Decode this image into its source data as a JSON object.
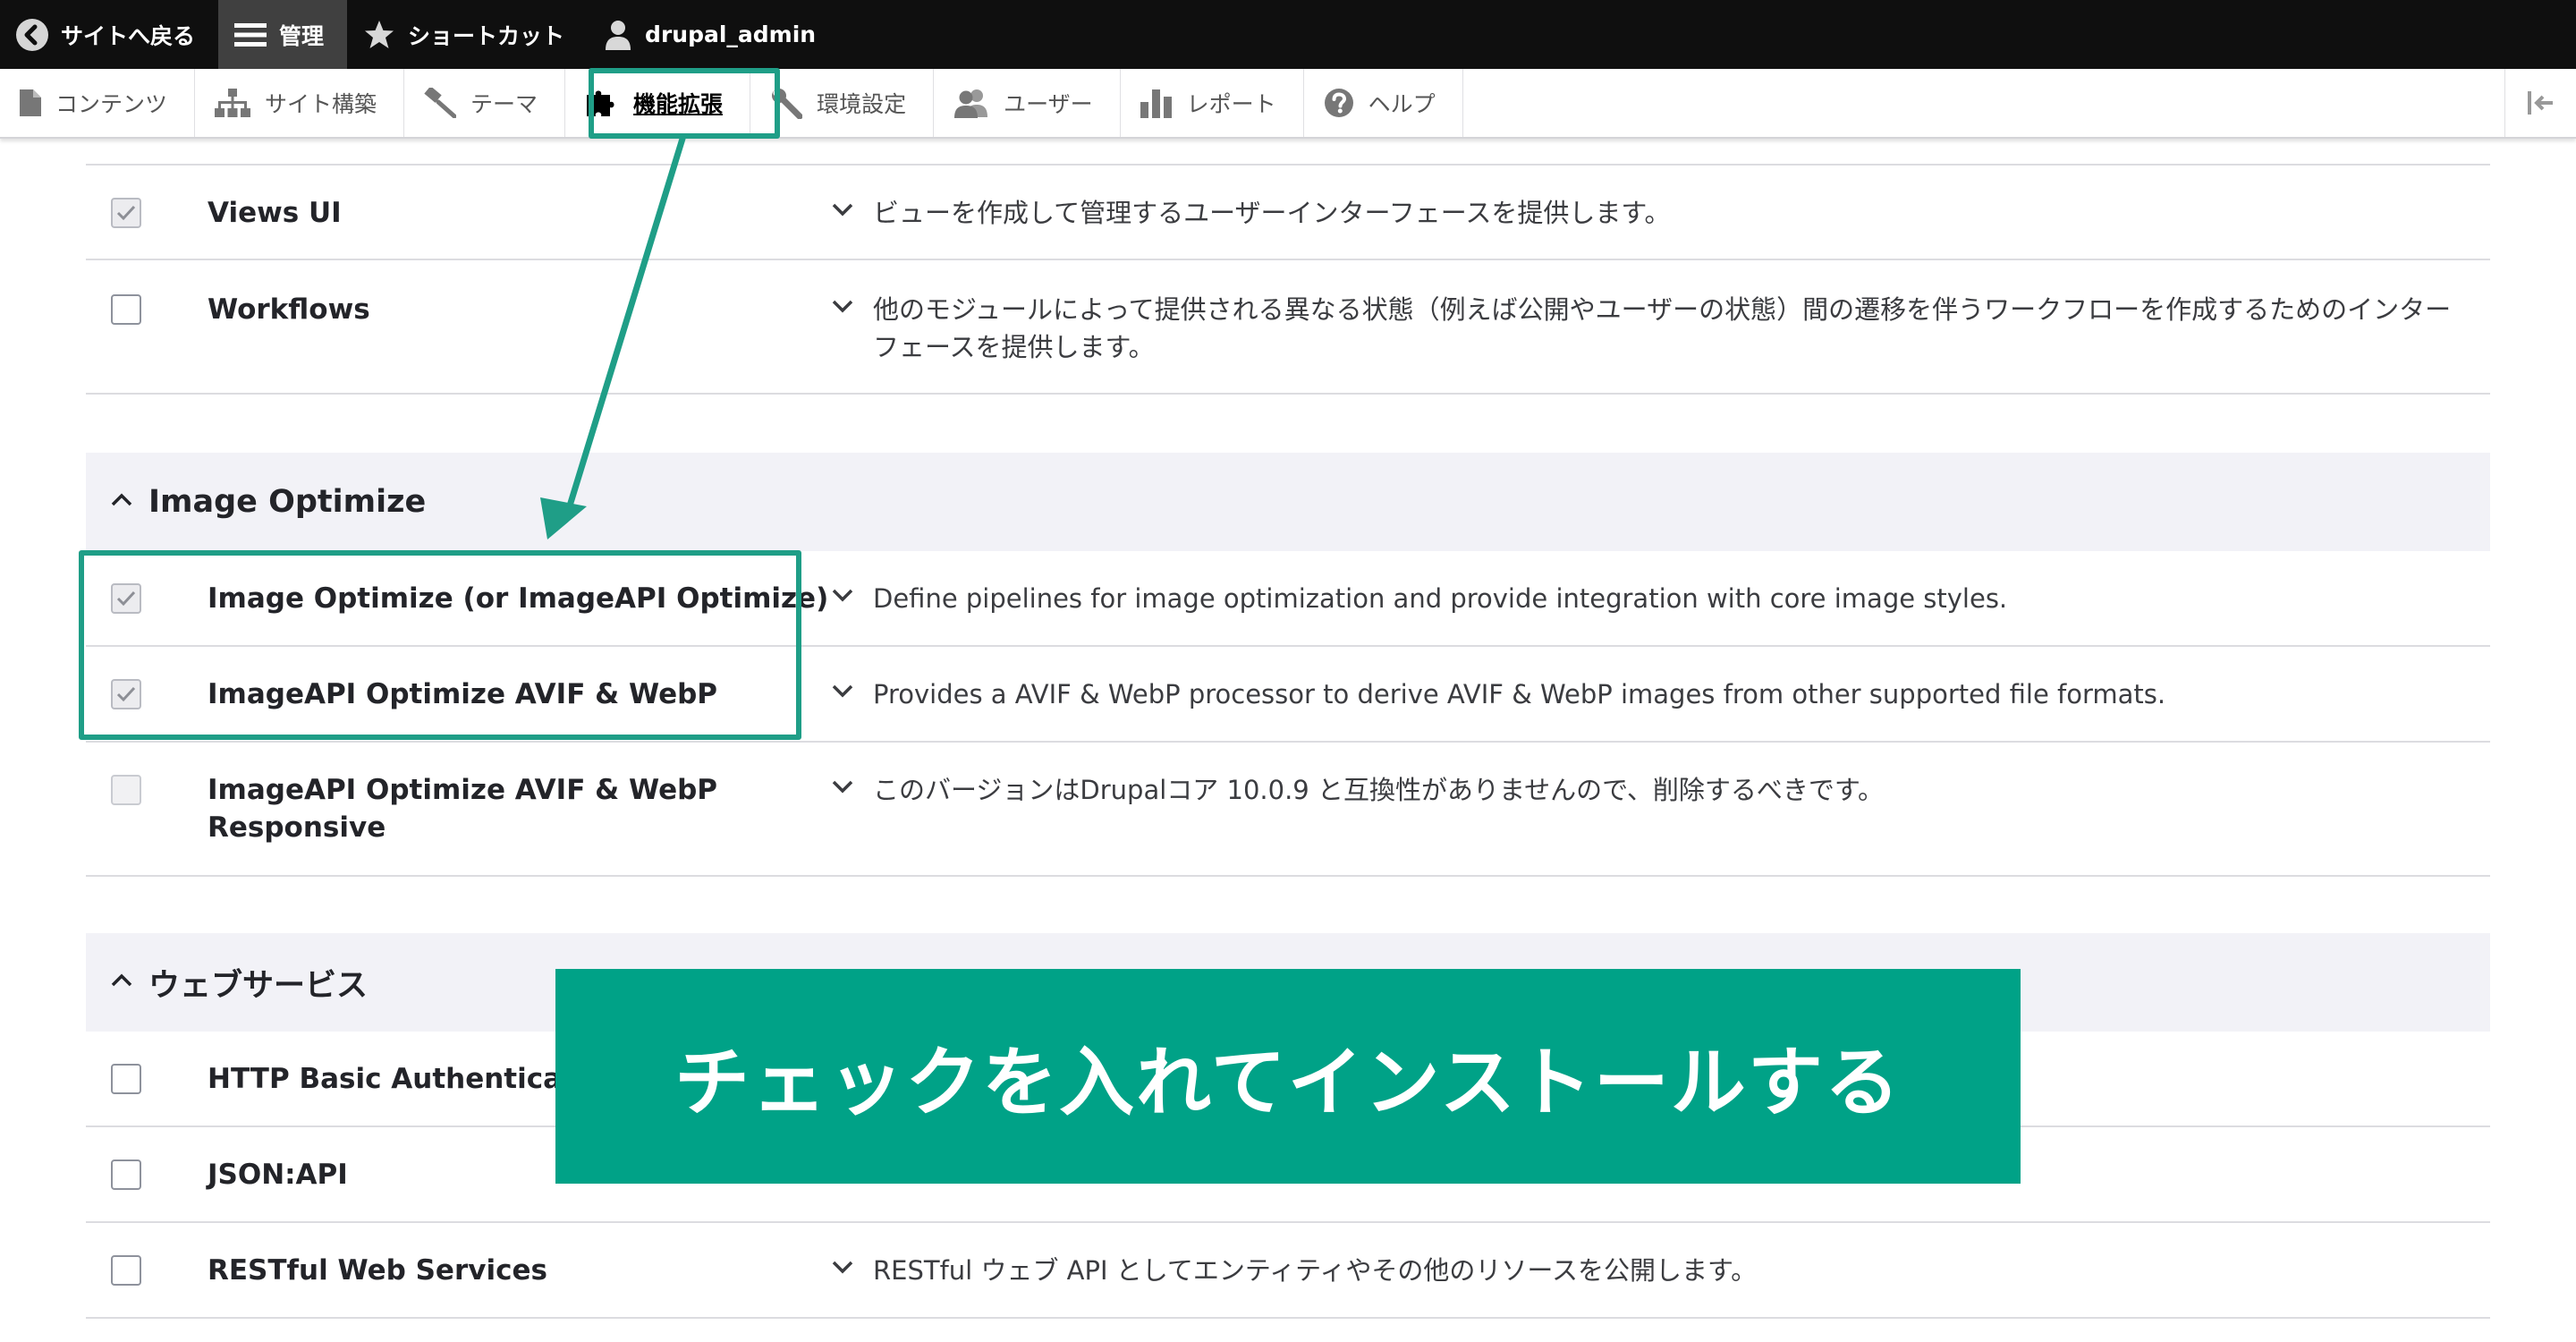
{
  "toolbar": {
    "back": "サイトへ戻る",
    "manage": "管理",
    "shortcuts": "ショートカット",
    "user": "drupal_admin"
  },
  "tray": {
    "content": "コンテンツ",
    "structure": "サイト構築",
    "appearance": "テーマ",
    "extend": "機能拡張",
    "config": "環境設定",
    "people": "ユーザー",
    "reports": "レポート",
    "help": "ヘルプ"
  },
  "modules": {
    "views_ui": {
      "name": "Views UI",
      "desc": "ビューを作成して管理するユーザーインターフェースを提供します。"
    },
    "workflows": {
      "name": "Workflows",
      "desc": "他のモジュールによって提供される異なる状態（例えば公開やユーザーの状態）間の遷移を伴うワークフローを作成するためのインターフェースを提供します。"
    }
  },
  "sections": {
    "image_optimize": {
      "title": "Image Optimize",
      "rows": [
        {
          "name": "Image Optimize (or ImageAPI Optimize)",
          "desc": "Define pipelines for image optimization and provide integration with core image styles."
        },
        {
          "name": "ImageAPI Optimize AVIF & WebP",
          "desc": "Provides a AVIF & WebP processor to derive AVIF & WebP images from other supported file formats."
        },
        {
          "name": "ImageAPI Optimize AVIF & WebP Responsive",
          "desc": "このバージョンはDrupalコア 10.0.9 と互換性がありませんので、削除するべきです。"
        }
      ]
    },
    "web_services": {
      "title": "ウェブサービス",
      "rows": [
        {
          "name": "HTTP Basic Authentication"
        },
        {
          "name": "JSON:API"
        },
        {
          "name": "RESTful Web Services",
          "desc": "RESTful ウェブ API としてエンティティやその他のリソースを公開します。"
        }
      ]
    }
  },
  "annotation": {
    "banner": "チェックを入れてインストールする",
    "color": "#1f9e87"
  }
}
